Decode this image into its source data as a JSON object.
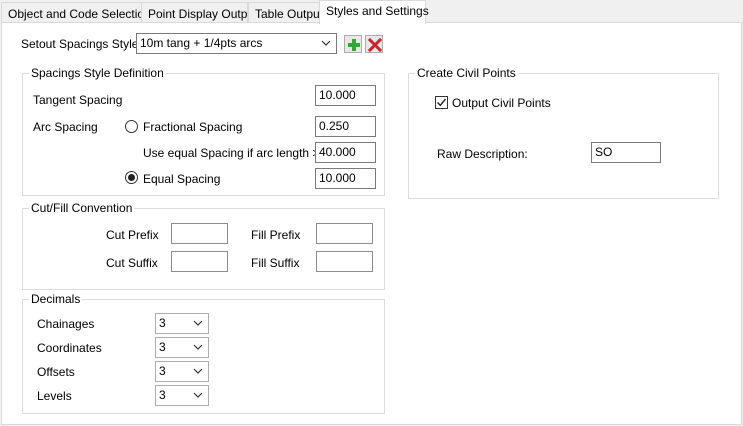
{
  "tabs": [
    {
      "label": "Object and Code Selection",
      "active": false
    },
    {
      "label": "Point Display Output",
      "active": false
    },
    {
      "label": "Table Output",
      "active": false
    },
    {
      "label": "Styles and Settings",
      "active": true
    }
  ],
  "setout": {
    "label": "Setout Spacings Style",
    "selected": "10m tang + 1/4pts arcs",
    "add_icon": "plus-icon",
    "delete_icon": "delete-x-icon",
    "add_color": "#2eaa2e",
    "delete_color": "#d0202a"
  },
  "spacings": {
    "title": "Spacings Style Definition",
    "tangent_label": "Tangent Spacing",
    "tangent_value": "10.000",
    "arc_label": "Arc Spacing",
    "fractional_label": "Fractional Spacing",
    "fractional_value": "0.250",
    "fractional_selected": false,
    "equal_if_label": "Use equal Spacing if arc length >",
    "equal_if_value": "40.000",
    "equal_label": "Equal Spacing",
    "equal_value": "10.000",
    "equal_selected": true
  },
  "cutfill": {
    "title": "Cut/Fill Convention",
    "cut_prefix_label": "Cut Prefix",
    "cut_prefix_value": "",
    "fill_prefix_label": "Fill Prefix",
    "fill_prefix_value": "",
    "cut_suffix_label": "Cut Suffix",
    "cut_suffix_value": "",
    "fill_suffix_label": "Fill Suffix",
    "fill_suffix_value": ""
  },
  "decimals": {
    "title": "Decimals",
    "rows": [
      {
        "label": "Chainages",
        "value": "3"
      },
      {
        "label": "Coordinates",
        "value": "3"
      },
      {
        "label": "Offsets",
        "value": "3"
      },
      {
        "label": "Levels",
        "value": "3"
      }
    ]
  },
  "civil": {
    "title": "Create Civil Points",
    "output_label": "Output Civil Points",
    "output_checked": true,
    "raw_desc_label": "Raw Description:",
    "raw_desc_value": "SO"
  }
}
